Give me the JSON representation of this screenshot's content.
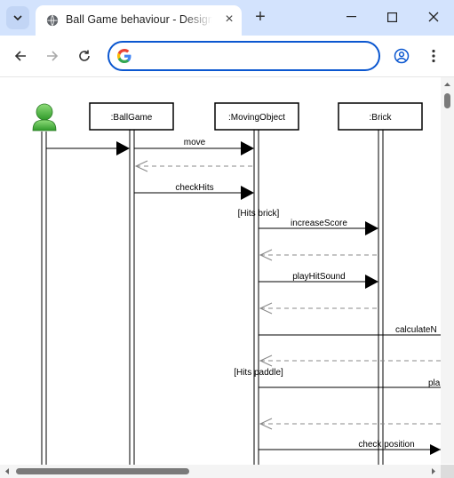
{
  "tab": {
    "title": "Ball Game behaviour - Design model",
    "favicon": "globe-icon"
  },
  "omnibox": {
    "value": "",
    "placeholder": ""
  },
  "diagram": {
    "lifelines": [
      ":BallGame",
      ":MovingObject",
      ":Brick"
    ],
    "guards": [
      "[Hits brick]",
      "[Hits paddle]"
    ],
    "messages": [
      "move",
      "checkHits",
      "increaseScore",
      "playHitSound",
      "calculateN",
      "pla",
      "check position"
    ]
  }
}
